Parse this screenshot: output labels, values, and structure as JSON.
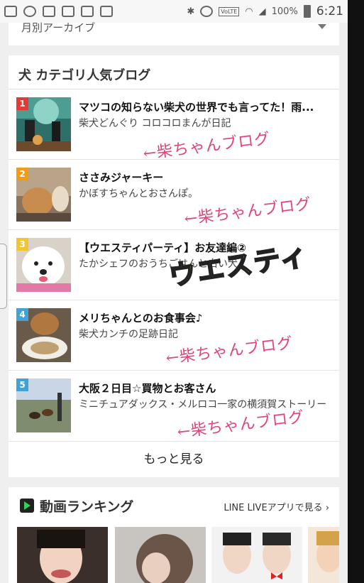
{
  "status_bar": {
    "battery": "100%",
    "time": "6:21",
    "volte": "VoLTE"
  },
  "archive": {
    "label": "月別アーカイブ"
  },
  "ranking": {
    "header": "犬 カテゴリ人気ブログ",
    "items": [
      {
        "rank": "1",
        "badge_color": "#e53935",
        "title": "マツコの知らない柴犬の世界でも言ってた！雨...",
        "subtitle": "柴犬どんぐり コロコロまんが日記"
      },
      {
        "rank": "2",
        "badge_color": "#f39c12",
        "title": "ささみジャーキー",
        "subtitle": "かぼすちゃんとおさんぽ。"
      },
      {
        "rank": "3",
        "badge_color": "#f4c430",
        "title": "【ウエスティパーティ】お友達編②",
        "subtitle": "たかシェフのおうちごはんと白い犬。"
      },
      {
        "rank": "4",
        "badge_color": "#3fa3d6",
        "title": "メリちゃんとのお食事会♪",
        "subtitle": "柴犬カンチの足跡日記"
      },
      {
        "rank": "5",
        "badge_color": "#3fa3d6",
        "title": "大阪２日目☆買物とお客さん",
        "subtitle": "ミニチュアダックス・メルロコ一家の横須賀ストーリー"
      }
    ],
    "more": "もっと見る"
  },
  "annotations": {
    "a1": "←柴ちゃんブログ",
    "a2": "←柴ちゃんブログ",
    "a3": "ウエスティ",
    "a4": "←柴ちゃんブログ",
    "a5": "←柴ちゃんブログ"
  },
  "video": {
    "title": "動画ランキング",
    "link": "LINE LIVEアプリで見る ›"
  }
}
